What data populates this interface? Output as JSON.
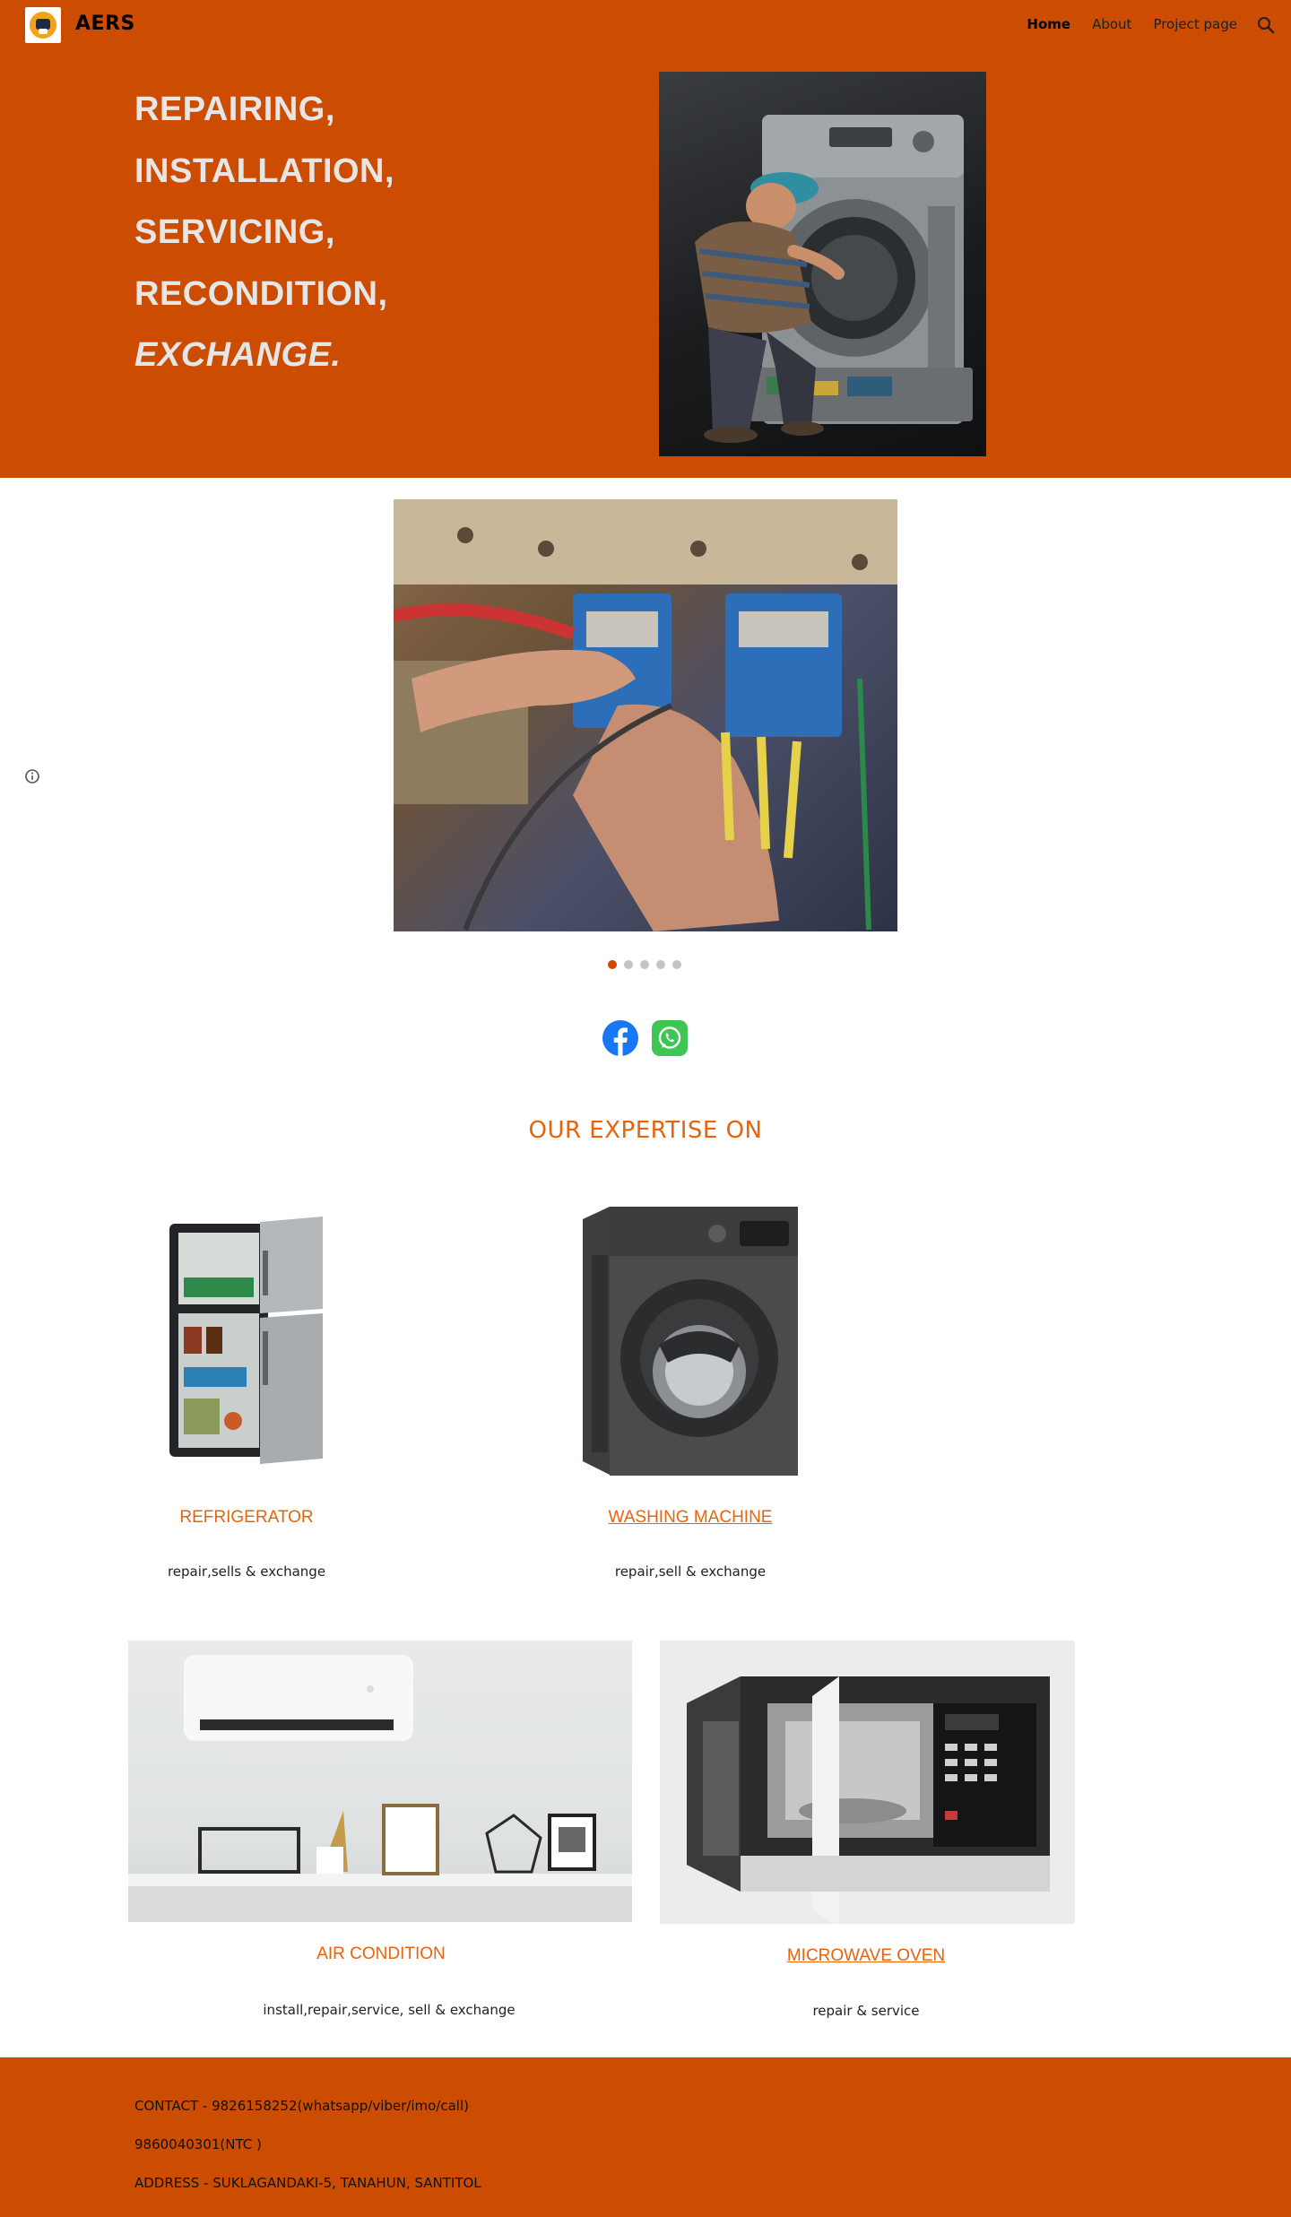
{
  "header": {
    "site_title": "AERS",
    "logo_icon": "aers-logo",
    "nav": [
      {
        "label": "Home",
        "active": true
      },
      {
        "label": "About",
        "active": false
      },
      {
        "label": "Project page",
        "active": false
      }
    ],
    "search_icon": "search-icon"
  },
  "hero": {
    "lines": [
      "REPAIRING,",
      "INSTALLATION,",
      "SERVICING,",
      "RECONDITION,",
      "EXCHANGE."
    ],
    "image_icon": "technician-repairing-washing-machine-image"
  },
  "carousel": {
    "image_icon": "hands-testing-electrical-panel-image",
    "slide_count": 5,
    "active_slide": 1
  },
  "social": {
    "facebook_icon": "facebook-icon",
    "whatsapp_icon": "whatsapp-icon"
  },
  "expertise": {
    "heading": "OUR EXPERTISE ON",
    "items": [
      {
        "title": "REFRIGERATOR",
        "desc": "repair,sells & exchange",
        "linked": false
      },
      {
        "title": "WASHING MACHINE",
        "desc": "repair,sell & exchange",
        "linked": true
      },
      {
        "title": "AIR CONDITION",
        "desc": "install,repair,service, sell & exchange",
        "linked": false
      },
      {
        "title": "MICROWAVE OVEN",
        "desc": "repair & service",
        "linked": true
      }
    ]
  },
  "footer": {
    "lines": [
      "CONTACT - 9826158252(whatsapp/viber/imo/call)",
      "9860040301(NTC )",
      "ADDRESS - SUKLAGANDAKI-5, TANAHUN, SANTITOL"
    ]
  },
  "colors": {
    "brand": "#cc4c02",
    "accent_text": "#e8630c",
    "hero_text": "#e6e6e6"
  }
}
